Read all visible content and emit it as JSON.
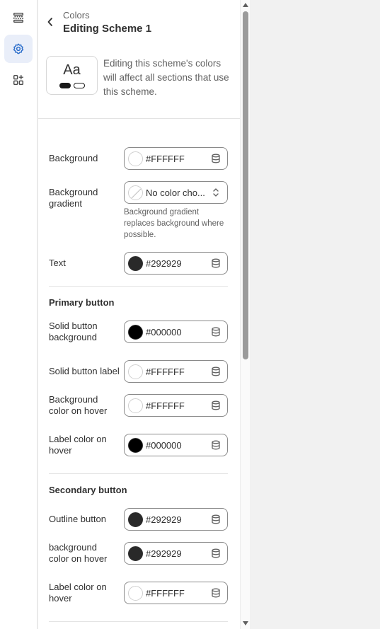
{
  "nav_rail": {
    "items": [
      {
        "icon": "sections-icon",
        "active": false
      },
      {
        "icon": "settings-gear-icon",
        "active": true
      },
      {
        "icon": "apps-add-icon",
        "active": false
      }
    ]
  },
  "header": {
    "breadcrumb": "Colors",
    "title": "Editing Scheme 1"
  },
  "preview": {
    "sample_text": "Aa"
  },
  "intro_text": "Editing this scheme's colors will affect all sections that use this scheme.",
  "fields": {
    "background": {
      "label": "Background",
      "value": "#FFFFFF",
      "swatch": "#FFFFFF"
    },
    "background_gradient": {
      "label": "Background gradient",
      "value": "No color cho...",
      "helper": "Background gradient replaces background where possible."
    },
    "text": {
      "label": "Text",
      "value": "#292929",
      "swatch": "#292929"
    }
  },
  "primary_button": {
    "title": "Primary button",
    "solid_bg": {
      "label": "Solid button background",
      "value": "#000000",
      "swatch": "#000000"
    },
    "solid_label": {
      "label": "Solid button label",
      "value": "#FFFFFF",
      "swatch": "#FFFFFF"
    },
    "bg_hover": {
      "label": "Background color on hover",
      "value": "#FFFFFF",
      "swatch": "#FFFFFF"
    },
    "label_hover": {
      "label": "Label color on hover",
      "value": "#000000",
      "swatch": "#000000"
    }
  },
  "secondary_button": {
    "title": "Secondary button",
    "outline": {
      "label": "Outline button",
      "value": "#292929",
      "swatch": "#292929"
    },
    "bg_hover": {
      "label": "background color on hover",
      "value": "#292929",
      "swatch": "#292929"
    },
    "label_hover": {
      "label": "Label color on hover",
      "value": "#FFFFFF",
      "swatch": "#FFFFFF"
    }
  },
  "colors": {
    "accent_active": "#2c6ecb",
    "field_border": "#8a8a8a"
  }
}
